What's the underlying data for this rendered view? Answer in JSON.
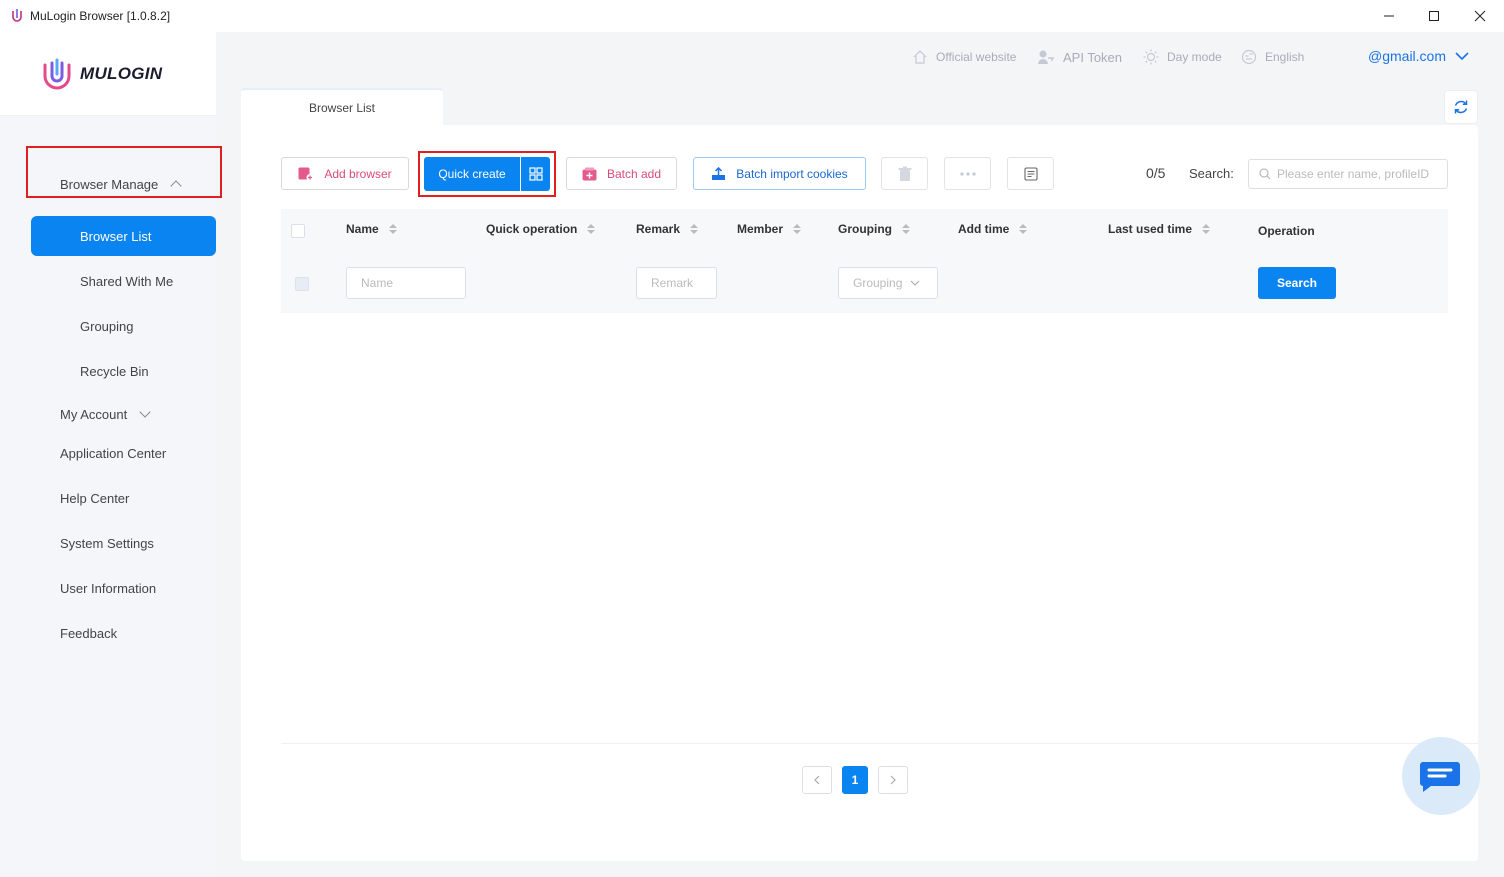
{
  "window": {
    "title": "MuLogin Browser  [1.0.8.2]",
    "controls": [
      "minimize",
      "maximize",
      "close"
    ]
  },
  "brand": {
    "logo_text": "MULOGIN",
    "accent": "#0a84f0"
  },
  "topbar": {
    "official_website": "Official website",
    "api_token": "API Token",
    "day_mode": "Day mode",
    "language": "English",
    "account": "@gmail.com"
  },
  "sidebar": {
    "items": [
      {
        "label": "Browser Manage",
        "type": "group",
        "expanded": true
      },
      {
        "label": "Browser List",
        "type": "sub",
        "active": true
      },
      {
        "label": "Shared With Me",
        "type": "sub"
      },
      {
        "label": "Grouping",
        "type": "sub"
      },
      {
        "label": "Recycle Bin",
        "type": "sub"
      },
      {
        "label": "My Account",
        "type": "group",
        "expanded": false
      },
      {
        "label": "Application Center",
        "type": "item"
      },
      {
        "label": "Help Center",
        "type": "item"
      },
      {
        "label": "System Settings",
        "type": "item"
      },
      {
        "label": "User Information",
        "type": "item"
      },
      {
        "label": "Feedback",
        "type": "item"
      }
    ]
  },
  "tabs": [
    {
      "label": "Browser List",
      "active": true
    }
  ],
  "toolbar": {
    "add_browser": "Add browser",
    "quick_create": "Quick create",
    "batch_add": "Batch add",
    "batch_import_cookies": "Batch import cookies",
    "count": "0/5",
    "search_label": "Search:",
    "search_placeholder": "Please enter name, profileID"
  },
  "table": {
    "columns": [
      "Name",
      "Quick operation",
      "Remark",
      "Member",
      "Grouping",
      "Add time",
      "Last used time",
      "Operation"
    ],
    "filters": {
      "name_placeholder": "Name",
      "remark_placeholder": "Remark",
      "grouping_placeholder": "Grouping",
      "search_button": "Search"
    },
    "rows": []
  },
  "pagination": {
    "current": "1",
    "pages": [
      "1"
    ]
  }
}
